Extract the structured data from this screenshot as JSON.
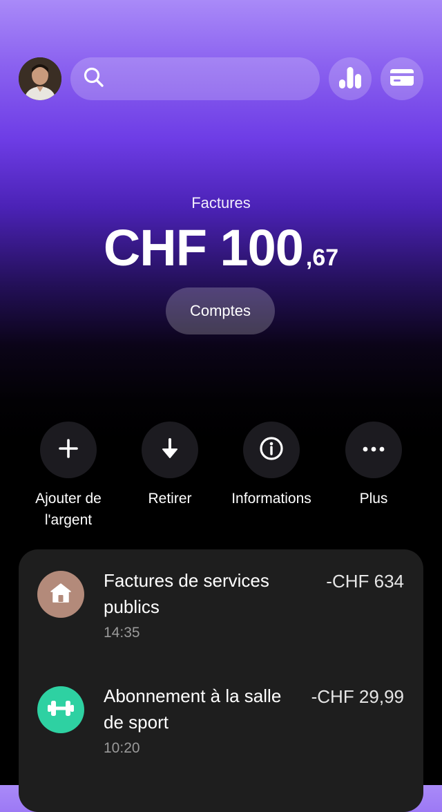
{
  "header": {
    "avatar_alt": "avatar",
    "search": {
      "value": "",
      "placeholder": ""
    },
    "stats_icon": "bar-chart-icon",
    "card_icon": "card-icon"
  },
  "balance": {
    "label": "Factures",
    "amount_main": "CHF 100",
    "amount_cents": ",67",
    "accounts_button": "Comptes"
  },
  "actions": [
    {
      "label": "Ajouter de l'argent",
      "icon": "plus-icon"
    },
    {
      "label": "Retirer",
      "icon": "arrow-down-icon"
    },
    {
      "label": "Informations",
      "icon": "info-icon"
    },
    {
      "label": "Plus",
      "icon": "more-icon"
    }
  ],
  "transactions": [
    {
      "title": "Factures de services publics",
      "time": "14:35",
      "amount": "-CHF 634",
      "icon": "house-icon",
      "color": "#b38a7a"
    },
    {
      "title": "Abonnement à la salle de sport",
      "time": "10:20",
      "amount": "-CHF 29,99",
      "icon": "dumbbell-icon",
      "color": "#2ed1a2"
    }
  ],
  "colors": {
    "gradient_top": "#a98af8",
    "gradient_mid": "#6e3de6",
    "background": "#000000",
    "card": "#1e1e1e",
    "action_circle": "#1c1b20"
  }
}
